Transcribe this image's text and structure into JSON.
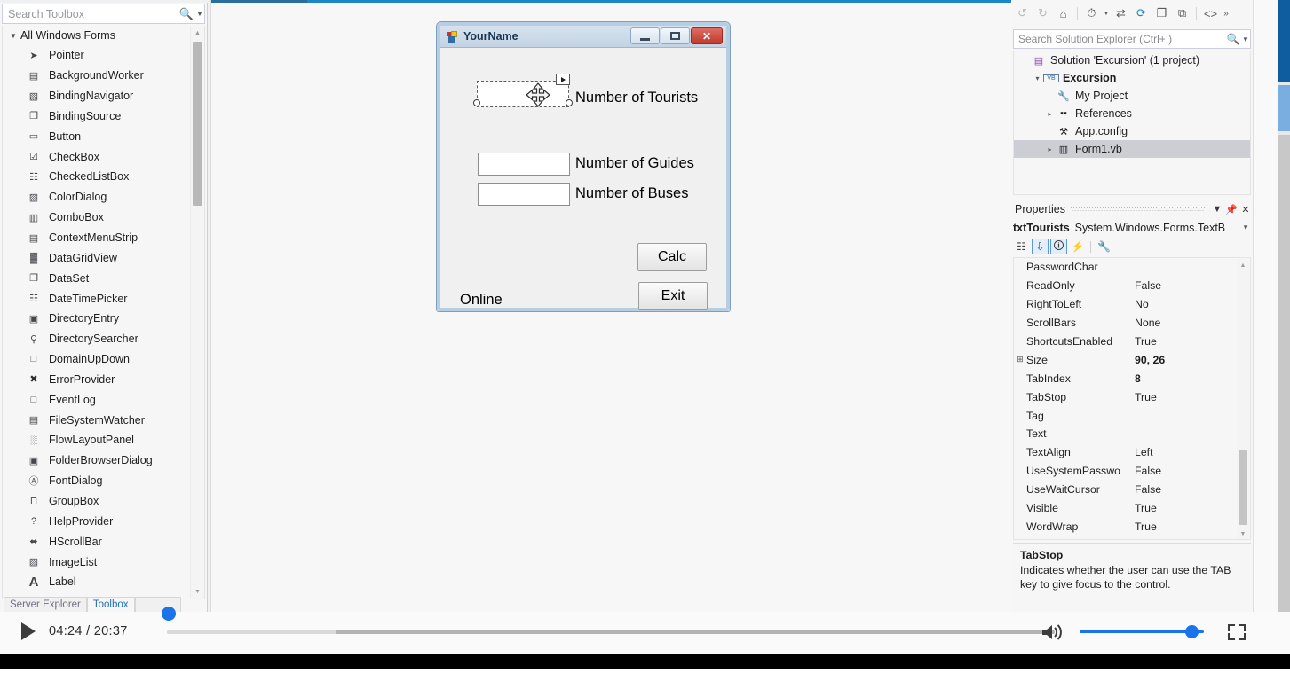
{
  "toolbox": {
    "search_placeholder": "Search Toolbox",
    "search_icon": "search-icon",
    "group_label": "All Windows Forms",
    "items": [
      {
        "label": "Pointer",
        "icon": "pointer-icon"
      },
      {
        "label": "BackgroundWorker",
        "icon": "backgroundworker-icon"
      },
      {
        "label": "BindingNavigator",
        "icon": "bindingnavigator-icon"
      },
      {
        "label": "BindingSource",
        "icon": "bindingsource-icon"
      },
      {
        "label": "Button",
        "icon": "button-icon"
      },
      {
        "label": "CheckBox",
        "icon": "checkbox-icon"
      },
      {
        "label": "CheckedListBox",
        "icon": "checkedlistbox-icon"
      },
      {
        "label": "ColorDialog",
        "icon": "colordialog-icon"
      },
      {
        "label": "ComboBox",
        "icon": "combobox-icon"
      },
      {
        "label": "ContextMenuStrip",
        "icon": "contextmenustrip-icon"
      },
      {
        "label": "DataGridView",
        "icon": "datagridview-icon"
      },
      {
        "label": "DataSet",
        "icon": "dataset-icon"
      },
      {
        "label": "DateTimePicker",
        "icon": "datetimepicker-icon"
      },
      {
        "label": "DirectoryEntry",
        "icon": "directoryentry-icon"
      },
      {
        "label": "DirectorySearcher",
        "icon": "directorysearcher-icon"
      },
      {
        "label": "DomainUpDown",
        "icon": "domainupdown-icon"
      },
      {
        "label": "ErrorProvider",
        "icon": "errorprovider-icon"
      },
      {
        "label": "EventLog",
        "icon": "eventlog-icon"
      },
      {
        "label": "FileSystemWatcher",
        "icon": "filesystemwatcher-icon"
      },
      {
        "label": "FlowLayoutPanel",
        "icon": "flowlayoutpanel-icon"
      },
      {
        "label": "FolderBrowserDialog",
        "icon": "folderbrowserdialog-icon"
      },
      {
        "label": "FontDialog",
        "icon": "fontdialog-icon"
      },
      {
        "label": "GroupBox",
        "icon": "groupbox-icon"
      },
      {
        "label": "HelpProvider",
        "icon": "helpprovider-icon"
      },
      {
        "label": "HScrollBar",
        "icon": "hscrollbar-icon"
      },
      {
        "label": "ImageList",
        "icon": "imagelist-icon"
      },
      {
        "label": "Label",
        "icon": "label-icon"
      }
    ],
    "tabs": [
      {
        "label": "Server Explorer",
        "active": false
      },
      {
        "label": "Toolbox",
        "active": true
      }
    ]
  },
  "designer": {
    "form": {
      "title": "YourName",
      "icon": "vb-form-icon",
      "minimize_label": "minimize-button",
      "maximize_label": "maximize-button",
      "close_label": "✕",
      "labels": {
        "tourists": "Number of Tourists",
        "guides": "Number of Guides",
        "buses": "Number of Buses",
        "status": "Online"
      },
      "textbox_values": {
        "tourists": "",
        "guides": "",
        "buses": ""
      },
      "buttons": {
        "calc": "Calc",
        "exit": "Exit"
      },
      "selection": {
        "smart_tag_icon": "smart-tag-icon",
        "move_cursor_icon": "move-cursor-icon"
      }
    }
  },
  "solution_explorer": {
    "toolbar_icons": [
      "back-arrow-icon",
      "forward-arrow-icon",
      "home-icon",
      "pending-changes-icon",
      "sync-with-active-document-icon",
      "refresh-icon",
      "collapse-all-icon",
      "show-all-files-icon",
      "view-code-icon",
      "overflow-icon"
    ],
    "search_placeholder": "Search Solution Explorer (Ctrl+;)",
    "search_icon": "search-icon",
    "tree": [
      {
        "label": "Solution 'Excursion' (1 project)",
        "icon": "solution-icon",
        "indent": 0,
        "expander": "",
        "bold": false,
        "selected": false
      },
      {
        "label": "Excursion",
        "icon": "vb-project-icon",
        "indent": 1,
        "expander": "▾",
        "bold": true,
        "selected": false
      },
      {
        "label": "My Project",
        "icon": "wrench-icon",
        "indent": 2,
        "expander": "",
        "bold": false,
        "selected": false
      },
      {
        "label": "References",
        "icon": "references-icon",
        "indent": 2,
        "expander": "▸",
        "bold": false,
        "selected": false
      },
      {
        "label": "App.config",
        "icon": "config-file-icon",
        "indent": 2,
        "expander": "",
        "bold": false,
        "selected": false
      },
      {
        "label": "Form1.vb",
        "icon": "form-file-icon",
        "indent": 2,
        "expander": "▸",
        "bold": false,
        "selected": true
      }
    ]
  },
  "properties": {
    "title": "Properties",
    "header_buttons": [
      "dropdown-icon",
      "pin-icon",
      "close-icon"
    ],
    "object_name": "txtTourists",
    "object_type": "System.Windows.Forms.TextB",
    "object_dropdown_icon": "chevron-down-icon",
    "toolbar_icons": [
      {
        "name": "categorized-icon",
        "active": false
      },
      {
        "name": "alphabetical-icon",
        "active": true
      },
      {
        "name": "properties-icon",
        "active": true
      },
      {
        "name": "events-icon",
        "active": false
      },
      {
        "name": "property-pages-icon",
        "active": false
      }
    ],
    "rows": [
      {
        "key": "PasswordChar",
        "value": "",
        "expandable": false,
        "bold": false
      },
      {
        "key": "ReadOnly",
        "value": "False",
        "expandable": false,
        "bold": false
      },
      {
        "key": "RightToLeft",
        "value": "No",
        "expandable": false,
        "bold": false
      },
      {
        "key": "ScrollBars",
        "value": "None",
        "expandable": false,
        "bold": false
      },
      {
        "key": "ShortcutsEnabled",
        "value": "True",
        "expandable": false,
        "bold": false
      },
      {
        "key": "Size",
        "value": "90, 26",
        "expandable": true,
        "bold": true
      },
      {
        "key": "TabIndex",
        "value": "8",
        "expandable": false,
        "bold": true
      },
      {
        "key": "TabStop",
        "value": "True",
        "expandable": false,
        "bold": false
      },
      {
        "key": "Tag",
        "value": "",
        "expandable": false,
        "bold": false
      },
      {
        "key": "Text",
        "value": "",
        "expandable": false,
        "bold": false
      },
      {
        "key": "TextAlign",
        "value": "Left",
        "expandable": false,
        "bold": false
      },
      {
        "key": "UseSystemPasswo",
        "value": "False",
        "expandable": false,
        "bold": false
      },
      {
        "key": "UseWaitCursor",
        "value": "False",
        "expandable": false,
        "bold": false
      },
      {
        "key": "Visible",
        "value": "True",
        "expandable": false,
        "bold": false
      },
      {
        "key": "WordWrap",
        "value": "True",
        "expandable": false,
        "bold": false
      }
    ],
    "description": {
      "title": "TabStop",
      "text": "Indicates whether the user can use the TAB key to give focus to the control."
    }
  },
  "player": {
    "play_icon": "play-icon",
    "current_time": "04:24",
    "duration": "20:37",
    "time_display": "04:24 / 20:37",
    "volume_icon": "volume-icon",
    "fullscreen_icon": "fullscreen-icon",
    "progress_percent": 21,
    "volume_percent": 85
  },
  "colors": {
    "accent_blue": "#1a73e8",
    "vs_blue": "#1c86c8",
    "selection_gray": "#cdcdd4",
    "close_red": "#c0392b"
  }
}
